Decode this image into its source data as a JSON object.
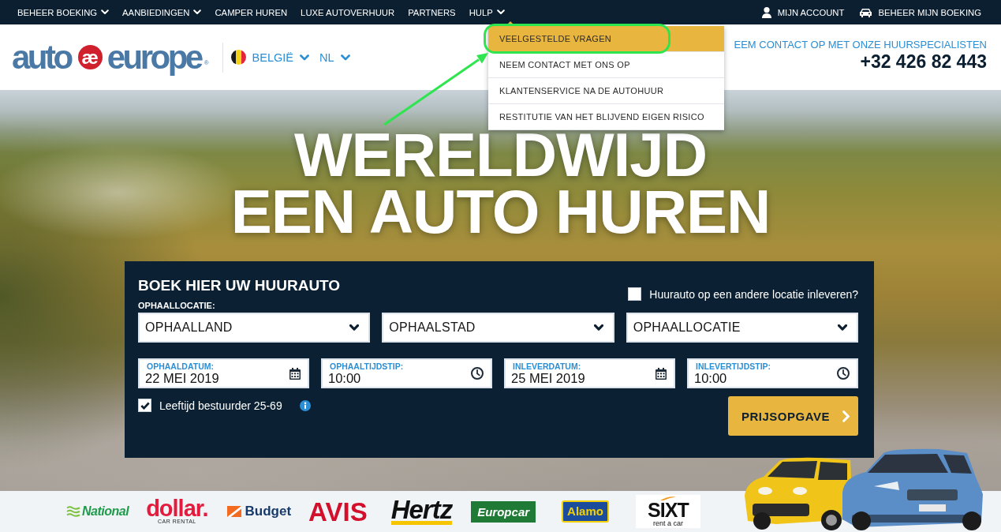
{
  "top_nav": {
    "items": [
      {
        "label": "BEHEER BOEKING",
        "dropdown": true
      },
      {
        "label": "AANBIEDINGEN",
        "dropdown": true
      },
      {
        "label": "CAMPER HUREN",
        "dropdown": false
      },
      {
        "label": "LUXE AUTOVERHUUR",
        "dropdown": false
      },
      {
        "label": "PARTNERS",
        "dropdown": false
      },
      {
        "label": "HULP",
        "dropdown": true
      }
    ],
    "account_links": [
      {
        "label": "MIJN ACCOUNT",
        "kind": "user"
      },
      {
        "label": "BEHEER MIJN BOEKING",
        "kind": "car"
      }
    ]
  },
  "help_menu": {
    "items": [
      {
        "label": "VEELGESTELDE VRAGEN",
        "selected": true
      },
      {
        "label": "NEEM CONTACT MET ONS OP",
        "selected": false
      },
      {
        "label": "KLANTENSERVICE NA DE AUTOHUUR",
        "selected": false
      },
      {
        "label": "RESTITUTIE VAN HET BLIJVEND EIGEN RISICO",
        "selected": false
      }
    ]
  },
  "header": {
    "logo": {
      "before": "auto",
      "mark": "æ",
      "after": "europe",
      "registered": "®"
    },
    "country": {
      "label": "BELGIË"
    },
    "language": {
      "label": "NL"
    },
    "contact": {
      "caption": "EEM CONTACT OP MET ONZE HUURSPECIALISTEN",
      "phone": "+32 426 82 443"
    }
  },
  "hero": {
    "title_lines": [
      "WERELDWIJD",
      "EEN AUTO HUREN"
    ]
  },
  "booking": {
    "title": "BOEK HIER UW HUURAUTO",
    "return_elsewhere": {
      "label": "Huurauto op een andere locatie inleveren?",
      "checked": false
    },
    "location_label": "OPHAALLOCATIE:",
    "selects": [
      {
        "value": "OPHAALLAND"
      },
      {
        "value": "OPHAALSTAD"
      },
      {
        "value": "OPHAALLOCATIE"
      }
    ],
    "when": [
      {
        "kind": "date",
        "label": "OPHAALDATUM:",
        "value": "22 MEI 2019"
      },
      {
        "kind": "time",
        "label": "OPHAALTIJDSTIP:",
        "value": "10:00"
      },
      {
        "kind": "date",
        "label": "INLEVERDATUM:",
        "value": "25 MEI 2019"
      },
      {
        "kind": "time",
        "label": "INLEVERTIJDSTIP:",
        "value": "10:00"
      }
    ],
    "driver_age": {
      "label": "Leeftijd bestuurder 25-69",
      "checked": true
    },
    "submit": "PRIJSOPGAVE"
  },
  "partners": [
    {
      "name": "National",
      "kind": "wave",
      "color": "#1e9b4b"
    },
    {
      "name": "dollar.",
      "tagline": "CAR RENTAL",
      "kind": "stacked",
      "color": "#e31b3d"
    },
    {
      "name": "Budget",
      "kind": "square",
      "color": "#173a6a"
    },
    {
      "name": "AVIS",
      "kind": "plain",
      "color": "#d2102c"
    },
    {
      "name": "Hertz",
      "kind": "underline",
      "color": "#111111"
    },
    {
      "name": "Europcar",
      "kind": "box",
      "color": "#1f7a35"
    },
    {
      "name": "Alamo",
      "kind": "framed",
      "color": "#1c4d9c"
    },
    {
      "name": "SIXT",
      "tagline": "rent a car",
      "kind": "card",
      "color": "#111111"
    }
  ]
}
